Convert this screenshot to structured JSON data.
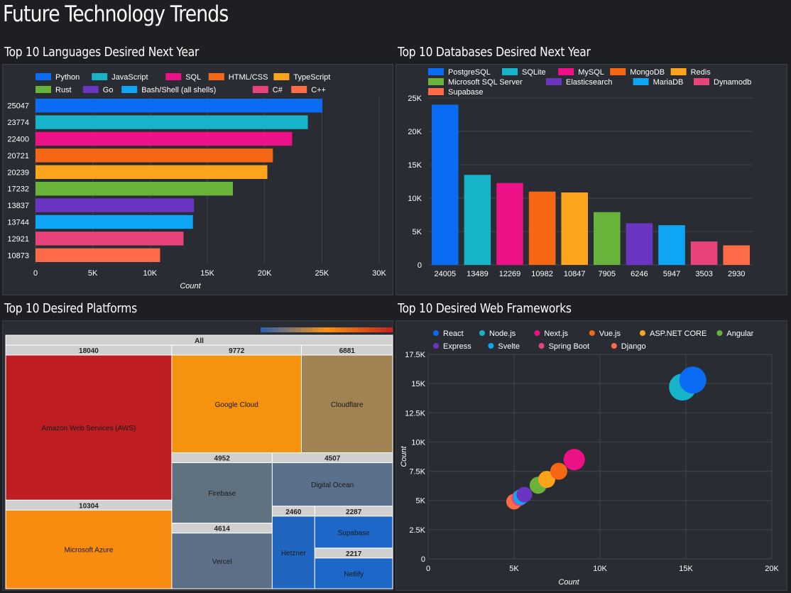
{
  "dashboard": {
    "title": "Future Technology Trends",
    "panels": {
      "languages": "Top 10 Languages Desired Next Year",
      "databases": "Top 10 Databases Desired Next Year",
      "platforms": "Top 10 Desired Platforms",
      "frameworks": "Top 10 Desired Web Frameworks"
    }
  },
  "chart_data": [
    {
      "id": "languages",
      "type": "bar",
      "orientation": "horizontal",
      "title": "Top 10 Languages Desired Next Year",
      "xlabel": "Count",
      "xlim": [
        0,
        30000
      ],
      "xticks": [
        0,
        5000,
        10000,
        15000,
        20000,
        25000,
        30000
      ],
      "xtick_labels": [
        "0",
        "5K",
        "10K",
        "15K",
        "20K",
        "25K",
        "30K"
      ],
      "grid": true,
      "legend": "top",
      "categories": [
        "Python",
        "JavaScript",
        "SQL",
        "HTML/CSS",
        "TypeScript",
        "Rust",
        "Go",
        "Bash/Shell (all shells)",
        "C#",
        "C++"
      ],
      "values": [
        25047,
        23774,
        22400,
        20721,
        20239,
        17232,
        13837,
        13744,
        12921,
        10873
      ],
      "colors": [
        "#0a6cf2",
        "#17b3c8",
        "#ec1187",
        "#f56714",
        "#fca41c",
        "#6ab33b",
        "#6a35c0",
        "#0ea5f5",
        "#e8437a",
        "#fd6b47"
      ]
    },
    {
      "id": "databases",
      "type": "bar",
      "orientation": "vertical",
      "title": "Top 10 Databases Desired Next Year",
      "ylim": [
        0,
        25000
      ],
      "yticks": [
        0,
        5000,
        10000,
        15000,
        20000,
        25000
      ],
      "ytick_labels": [
        "0",
        "5K",
        "10K",
        "15K",
        "20K",
        "25K"
      ],
      "grid": true,
      "legend": "top",
      "categories": [
        "PostgreSQL",
        "SQLite",
        "MySQL",
        "MongoDB",
        "Redis",
        "Microsoft SQL Server",
        "Elasticsearch",
        "MariaDB",
        "Dynamodb",
        "Supabase"
      ],
      "values": [
        24005,
        13489,
        12269,
        10982,
        10847,
        7905,
        6246,
        5947,
        3503,
        2930
      ],
      "colors": [
        "#0a6cf2",
        "#17b3c8",
        "#ec1187",
        "#f56714",
        "#fca41c",
        "#6ab33b",
        "#6a35c0",
        "#0ea5f5",
        "#e8437a",
        "#fd6b47"
      ]
    },
    {
      "id": "platforms",
      "type": "treemap",
      "title": "Top 10 Desired Platforms",
      "root_label": "All",
      "color_scale": [
        "#2b5fb0",
        "#f5930f",
        "#c8201e"
      ],
      "nodes": [
        {
          "name": "Amazon Web Services (AWS)",
          "value": 18040,
          "color": "#be1e22"
        },
        {
          "name": "Microsoft Azure",
          "value": 10304,
          "color": "#f78c10"
        },
        {
          "name": "Google Cloud",
          "value": 9772,
          "color": "#f5920e"
        },
        {
          "name": "Cloudflare",
          "value": 6881,
          "color": "#a08253"
        },
        {
          "name": "Firebase",
          "value": 4952,
          "color": "#60717f"
        },
        {
          "name": "Digital Ocean",
          "value": 4507,
          "color": "#5b708a"
        },
        {
          "name": "Vercel",
          "value": 4614,
          "color": "#5e7087"
        },
        {
          "name": "Hetzner",
          "value": 2460,
          "color": "#2065c0"
        },
        {
          "name": "Supabase",
          "value": 2287,
          "color": "#1c67c7"
        },
        {
          "name": "Netlify",
          "value": 2217,
          "color": "#1c67c7"
        }
      ]
    },
    {
      "id": "frameworks",
      "type": "scatter",
      "title": "Top 10 Desired Web Frameworks",
      "xlabel": "Count",
      "ylabel": "Count",
      "xlim": [
        0,
        20000
      ],
      "ylim": [
        0,
        17500
      ],
      "xticks": [
        0,
        5000,
        10000,
        15000,
        20000
      ],
      "xtick_labels": [
        "0",
        "5K",
        "10K",
        "15K",
        "20K"
      ],
      "yticks": [
        0,
        2500,
        5000,
        7500,
        10000,
        12500,
        15000,
        17500
      ],
      "ytick_labels": [
        "0",
        "2.5K",
        "5K",
        "7.5K",
        "10K",
        "12.5K",
        "15K",
        "17.5K"
      ],
      "grid": true,
      "legend": "top",
      "series": [
        {
          "name": "React",
          "x": 15400,
          "y": 15300,
          "color": "#0a6cf2"
        },
        {
          "name": "Node.js",
          "x": 14800,
          "y": 14700,
          "color": "#17b3c8"
        },
        {
          "name": "Next.js",
          "x": 8500,
          "y": 8500,
          "color": "#ec1187"
        },
        {
          "name": "Vue.js",
          "x": 7600,
          "y": 7500,
          "color": "#f56714"
        },
        {
          "name": "ASP.NET CORE",
          "x": 6900,
          "y": 6800,
          "color": "#fca41c"
        },
        {
          "name": "Angular",
          "x": 6400,
          "y": 6300,
          "color": "#6ab33b"
        },
        {
          "name": "Express",
          "x": 5600,
          "y": 5500,
          "color": "#6a35c0"
        },
        {
          "name": "Svelte",
          "x": 5400,
          "y": 5300,
          "color": "#0ea5f5"
        },
        {
          "name": "Spring Boot",
          "x": 5300,
          "y": 5200,
          "color": "#e8437a"
        },
        {
          "name": "Django",
          "x": 5000,
          "y": 4900,
          "color": "#fd6b47"
        }
      ]
    }
  ]
}
